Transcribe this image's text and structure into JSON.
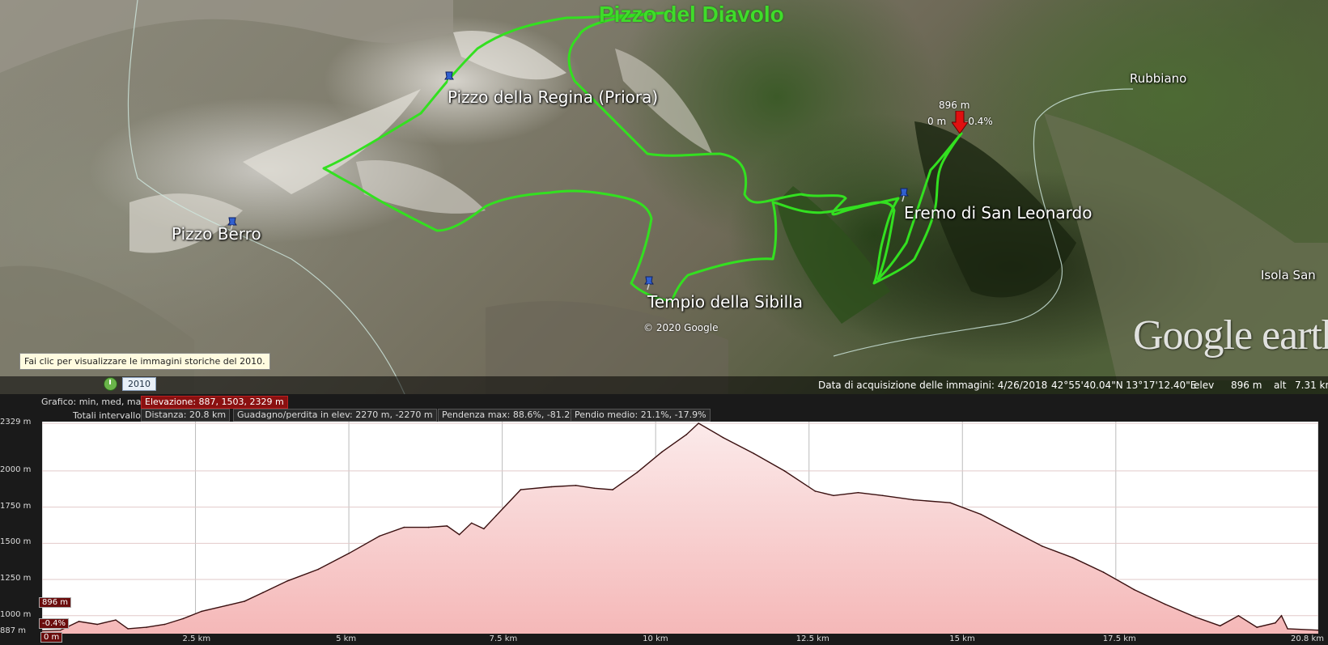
{
  "map": {
    "peak_title": "Pizzo del Diavolo",
    "places": {
      "pizzo_regina": "Pizzo della Regina (Priora)",
      "pizzo_berro": "Pizzo Berro",
      "tempio_sibilla": "Tempio della Sibilla",
      "eremo": "Eremo di San Leonardo",
      "rubbiano": "Rubbiano",
      "isola": "Isola San"
    },
    "copyright": "© 2020 Google",
    "logo": "Google earth",
    "tooltip": "Fai clic per visualizzare le immagini storiche del 2010.",
    "history_year": "2010",
    "marker": {
      "elev": "896 m",
      "dist": "0 m",
      "slope": "-0.4%"
    },
    "status": {
      "acq_date": "Data di acquisizione delle immagini: 4/26/2018",
      "lat": "42°55'40.04\"N",
      "lon": "13°17'12.40\"E",
      "elev_label": "elev",
      "elev_value": "896 m",
      "alt_label": "alt",
      "alt_value": "7.31 km"
    },
    "colors": {
      "track": "#33e020",
      "marker": "#e01010"
    },
    "icons": [
      "pushpin-icon",
      "clock-icon",
      "red-arrow-icon"
    ]
  },
  "profile": {
    "stats": {
      "graph_label": "Grafico: min, med, max",
      "elevation": "Elevazione: 887, 1503, 2329 m",
      "range_label": "Totali intervallo:",
      "distance": "Distanza: 20.8 km",
      "gain_loss": "Guadagno/perdita in elev: 2270 m, -2270 m",
      "max_slope": "Pendenza max: 88.6%, -81.2%",
      "avg_slope": "Pendio medio: 21.1%, -17.9%"
    },
    "current": {
      "elev": "896 m",
      "slope": "-0.4%",
      "dist": "0 m"
    }
  },
  "chart_data": {
    "type": "area",
    "title": "",
    "xlabel": "",
    "ylabel": "",
    "xlim": [
      0,
      20.8
    ],
    "ylim": [
      887,
      2329
    ],
    "x_ticks": [
      {
        "value": 0,
        "label": "0 m"
      },
      {
        "value": 2.5,
        "label": "2.5 km"
      },
      {
        "value": 5,
        "label": "5 km"
      },
      {
        "value": 7.5,
        "label": "7.5 km"
      },
      {
        "value": 10,
        "label": "10 km"
      },
      {
        "value": 12.5,
        "label": "12.5 km"
      },
      {
        "value": 15,
        "label": "15 km"
      },
      {
        "value": 17.5,
        "label": "17.5 km"
      },
      {
        "value": 20.8,
        "label": "20.8 km"
      }
    ],
    "y_ticks": [
      {
        "value": 887,
        "label": "887 m"
      },
      {
        "value": 1000,
        "label": "1000 m"
      },
      {
        "value": 1250,
        "label": "1250 m"
      },
      {
        "value": 1500,
        "label": "1500 m"
      },
      {
        "value": 1750,
        "label": "1750 m"
      },
      {
        "value": 2000,
        "label": "2000 m"
      },
      {
        "value": 2329,
        "label": "2329 m"
      }
    ],
    "series": [
      {
        "color": "#3a1010",
        "fill": "#f5b8b8",
        "points": [
          [
            0,
            896
          ],
          [
            0.3,
            900
          ],
          [
            0.6,
            960
          ],
          [
            0.9,
            940
          ],
          [
            1.2,
            970
          ],
          [
            1.4,
            910
          ],
          [
            1.7,
            920
          ],
          [
            2.0,
            940
          ],
          [
            2.3,
            980
          ],
          [
            2.6,
            1030
          ],
          [
            3.0,
            1070
          ],
          [
            3.3,
            1100
          ],
          [
            3.6,
            1160
          ],
          [
            4.0,
            1240
          ],
          [
            4.5,
            1320
          ],
          [
            5.0,
            1430
          ],
          [
            5.5,
            1550
          ],
          [
            5.9,
            1610
          ],
          [
            6.3,
            1610
          ],
          [
            6.6,
            1620
          ],
          [
            6.8,
            1560
          ],
          [
            7.0,
            1640
          ],
          [
            7.2,
            1600
          ],
          [
            7.4,
            1690
          ],
          [
            7.8,
            1870
          ],
          [
            8.3,
            1890
          ],
          [
            8.7,
            1900
          ],
          [
            9.0,
            1880
          ],
          [
            9.3,
            1870
          ],
          [
            9.7,
            1990
          ],
          [
            10.1,
            2130
          ],
          [
            10.5,
            2250
          ],
          [
            10.7,
            2329
          ],
          [
            11.1,
            2230
          ],
          [
            11.6,
            2120
          ],
          [
            12.1,
            2000
          ],
          [
            12.6,
            1860
          ],
          [
            12.9,
            1830
          ],
          [
            13.3,
            1850
          ],
          [
            13.7,
            1830
          ],
          [
            14.2,
            1800
          ],
          [
            14.8,
            1780
          ],
          [
            15.3,
            1700
          ],
          [
            15.8,
            1590
          ],
          [
            16.3,
            1480
          ],
          [
            16.8,
            1400
          ],
          [
            17.3,
            1300
          ],
          [
            17.8,
            1180
          ],
          [
            18.3,
            1080
          ],
          [
            18.8,
            990
          ],
          [
            19.2,
            930
          ],
          [
            19.5,
            1000
          ],
          [
            19.8,
            920
          ],
          [
            20.1,
            950
          ],
          [
            20.2,
            1000
          ],
          [
            20.3,
            910
          ],
          [
            20.8,
            900
          ]
        ]
      }
    ],
    "grid": true
  }
}
